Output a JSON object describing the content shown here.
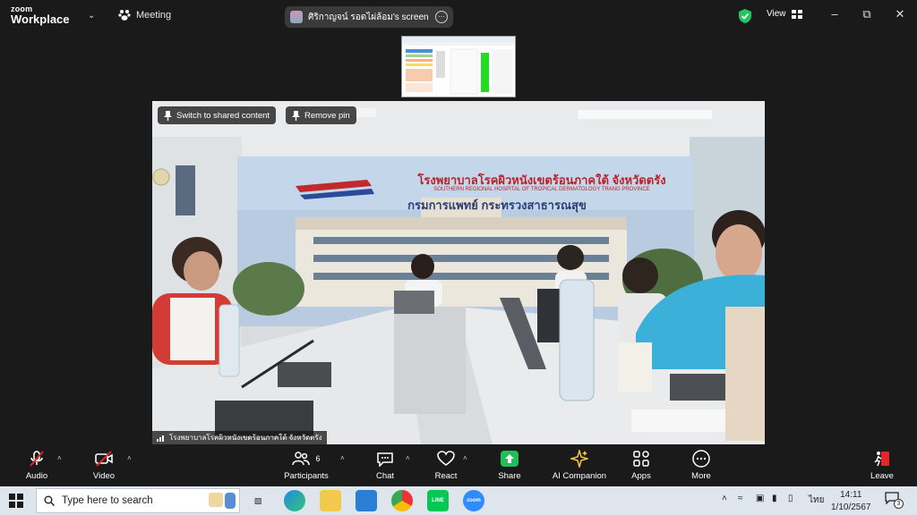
{
  "app": {
    "brand_top": "zoom",
    "brand_bottom": "Workplace",
    "meeting_label": "Meeting",
    "share_label": "ศิริกาญจน์ รอดไผ่ล้อม's screen",
    "view_label": "View"
  },
  "video": {
    "switch_label": "Switch to shared content",
    "remove_pin_label": "Remove pin",
    "participant_name": "โรงพยาบาลโรคผิวหนังเขตร้อนภาคใต้ จังหวัดตรัง",
    "banner_line1": "โรงพยาบาลโรคผิวหนังเขตร้อนภาคใต้ จังหวัดตรัง",
    "banner_line2": "SOUTHERN REGIONAL HOSPITAL OF TROPICAL DERMATOLOGY TRANG PROVINCE",
    "banner_line3": "กรมการแพทย์ กระทรวงสาธารณสุข"
  },
  "toolbar": {
    "audio": "Audio",
    "video": "Video",
    "participants": "Participants",
    "participants_count": "6",
    "chat": "Chat",
    "react": "React",
    "share": "Share",
    "ai": "AI Companion",
    "apps": "Apps",
    "more": "More",
    "leave": "Leave"
  },
  "taskbar": {
    "search_placeholder": "Type here to search",
    "language": "ไทย",
    "time": "14:11",
    "date": "1/10/2567",
    "notification_count": "3",
    "zoom_label": "zoom",
    "line_label": "LINE"
  },
  "colors": {
    "accent_green": "#22c55e",
    "share_green": "#1fbf5a",
    "taskbar_bg": "#dfe5ec"
  }
}
